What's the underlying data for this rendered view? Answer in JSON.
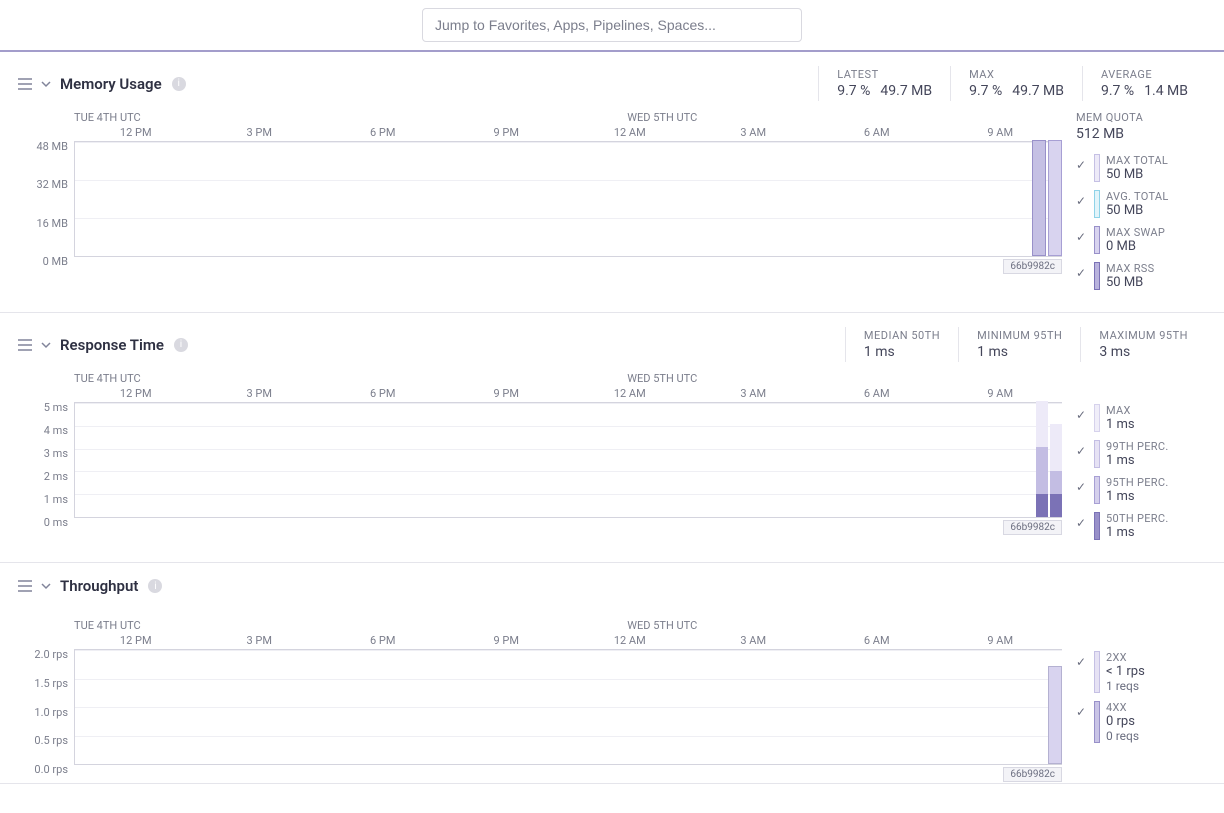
{
  "search": {
    "placeholder": "Jump to Favorites, Apps, Pipelines, Spaces..."
  },
  "timeline": {
    "day1": "TUE 4TH UTC",
    "day2": "WED 5TH UTC",
    "ticks": [
      "12 PM",
      "3 PM",
      "6 PM",
      "9 PM",
      "12 AM",
      "3 AM",
      "6 AM",
      "9 AM"
    ],
    "tag": "66b9982c"
  },
  "memory": {
    "title": "Memory Usage",
    "stats": {
      "latest": {
        "label": "LATEST",
        "pct": "9.7 %",
        "mb": "49.7 MB"
      },
      "max": {
        "label": "MAX",
        "pct": "9.7 %",
        "mb": "49.7 MB"
      },
      "avg": {
        "label": "AVERAGE",
        "pct": "9.7 %",
        "mb": "1.4 MB"
      }
    },
    "yaxis": [
      "48 MB",
      "32 MB",
      "16 MB",
      "0 MB"
    ],
    "quota": {
      "label": "MEM QUOTA",
      "value": "512 MB"
    },
    "legend": [
      {
        "label": "MAX TOTAL",
        "value": "50 MB",
        "color": "#c5c0e4",
        "fill": "#edeaf8"
      },
      {
        "label": "AVG. TOTAL",
        "value": "50 MB",
        "color": "#8fd3e8",
        "fill": "#e2f4fa"
      },
      {
        "label": "MAX SWAP",
        "value": "0 MB",
        "color": "#9890c9",
        "fill": "#d8d3ef"
      },
      {
        "label": "MAX RSS",
        "value": "50 MB",
        "color": "#7b72b6",
        "fill": "#b9b3dd"
      }
    ]
  },
  "response": {
    "title": "Response Time",
    "stats": {
      "median50": {
        "label": "MEDIAN 50TH",
        "value": "1 ms"
      },
      "min95": {
        "label": "MINIMUM 95TH",
        "value": "1 ms"
      },
      "max95": {
        "label": "MAXIMUM 95TH",
        "value": "3 ms"
      }
    },
    "yaxis": [
      "5 ms",
      "4 ms",
      "3 ms",
      "2 ms",
      "1 ms",
      "0 ms"
    ],
    "legend": [
      {
        "label": "MAX",
        "value": "1 ms",
        "color": "#d6d2ec",
        "fill": "#f0eef9"
      },
      {
        "label": "99TH PERC.",
        "value": "1 ms",
        "color": "#c3bde3",
        "fill": "#e6e2f4"
      },
      {
        "label": "95TH PERC.",
        "value": "1 ms",
        "color": "#a79fd4",
        "fill": "#d5d0ec"
      },
      {
        "label": "50TH PERC.",
        "value": "1 ms",
        "color": "#7b72b6",
        "fill": "#9890c9"
      }
    ]
  },
  "throughput": {
    "title": "Throughput",
    "yaxis": [
      "2.0 rps",
      "1.5 rps",
      "1.0 rps",
      "0.5 rps",
      "0.0 rps"
    ],
    "legend": [
      {
        "label": "2XX",
        "value": "< 1 rps",
        "value2": "1 reqs",
        "color": "#c5c0e4",
        "fill": "#e6e2f4"
      },
      {
        "label": "4XX",
        "value": "0 rps",
        "value2": "0 reqs",
        "color": "#9890c9",
        "fill": "#c9c4e6"
      }
    ]
  },
  "chart_data": [
    {
      "type": "bar",
      "title": "Memory Usage",
      "ylabel": "MB",
      "ylim": [
        0,
        48
      ],
      "x": [
        "Wed 5th ~10 AM"
      ],
      "series": [
        {
          "name": "MAX TOTAL",
          "values": [
            50
          ]
        },
        {
          "name": "AVG. TOTAL",
          "values": [
            50
          ]
        },
        {
          "name": "MAX SWAP",
          "values": [
            0
          ]
        },
        {
          "name": "MAX RSS",
          "values": [
            50
          ]
        }
      ],
      "summary": {
        "latest_pct": 9.7,
        "latest_mb": 49.7,
        "max_pct": 9.7,
        "max_mb": 49.7,
        "avg_pct": 9.7,
        "avg_mb": 1.4,
        "quota_mb": 512
      }
    },
    {
      "type": "bar",
      "title": "Response Time",
      "ylabel": "ms",
      "ylim": [
        0,
        5
      ],
      "x": [
        "Wed 5th ~10 AM (bucket1)",
        "Wed 5th ~10 AM (bucket2)"
      ],
      "series": [
        {
          "name": "MAX",
          "values": [
            5,
            4
          ]
        },
        {
          "name": "99TH PERC.",
          "values": [
            3,
            2
          ]
        },
        {
          "name": "95TH PERC.",
          "values": [
            3,
            2
          ]
        },
        {
          "name": "50TH PERC.",
          "values": [
            1,
            1
          ]
        }
      ],
      "summary": {
        "median_50th_ms": 1,
        "min_95th_ms": 1,
        "max_95th_ms": 3
      }
    },
    {
      "type": "bar",
      "title": "Throughput",
      "ylabel": "rps",
      "ylim": [
        0,
        2.0
      ],
      "x": [
        "Wed 5th ~10 AM"
      ],
      "series": [
        {
          "name": "2XX",
          "values": [
            1.7
          ],
          "reqs": 1
        },
        {
          "name": "4XX",
          "values": [
            0
          ],
          "reqs": 0
        }
      ]
    }
  ]
}
